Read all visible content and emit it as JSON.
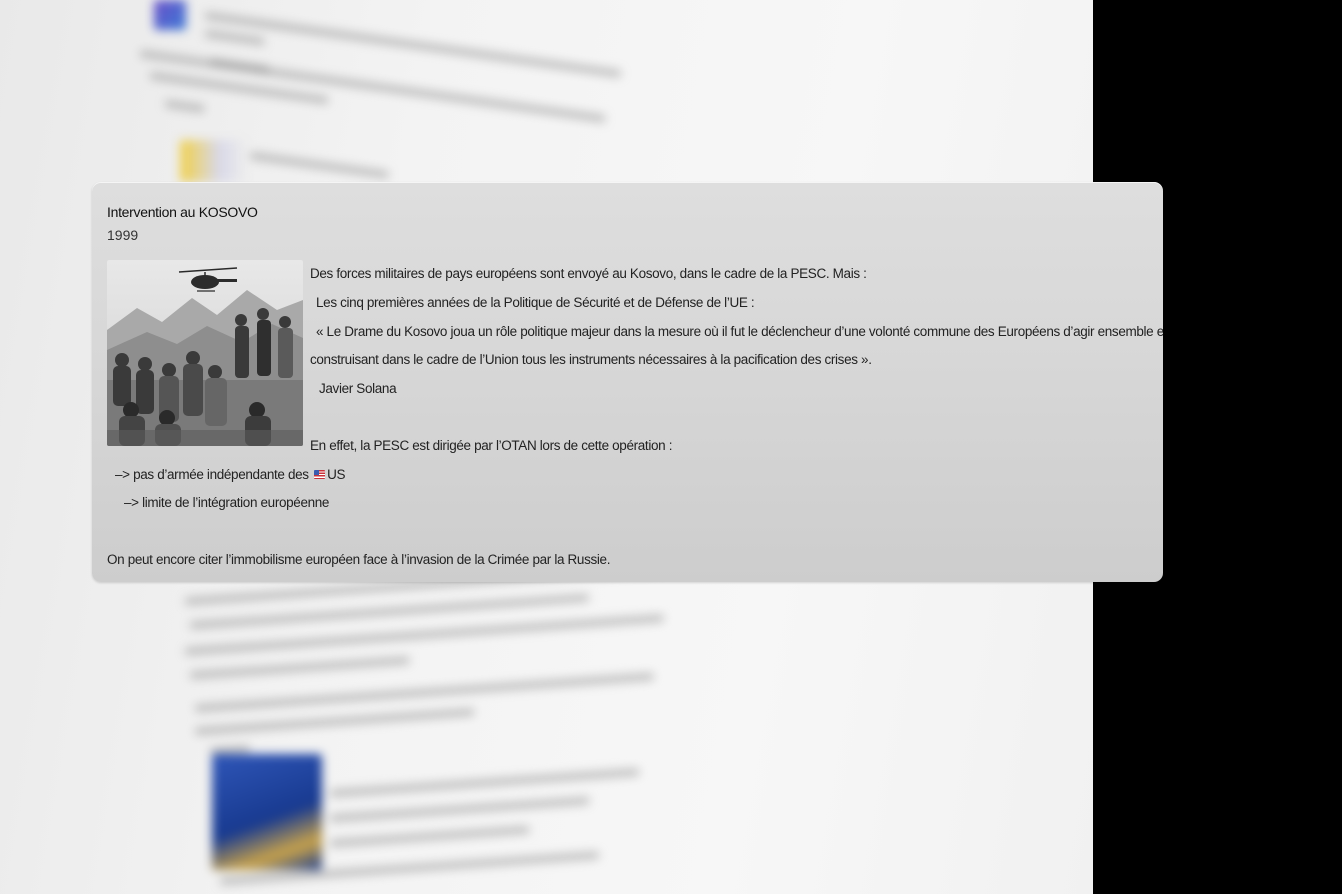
{
  "card": {
    "title": "Intervention au KOSOVO",
    "year": "1999",
    "lines": [
      "Des forces militaires de pays européens sont envoyé au Kosovo, dans le cadre de la PESC. Mais :",
      "Les cinq premières années  de la Politique de Sécurité et de Défense  de l’UE :",
      "« Le Drame du Kosovo joua un rôle politique majeur dans la   mesure où il fut le déclencheur d’une volonté commune des   Européens d’agir ensemble en",
      "construisant dans le cadre de l’Union   tous les  instruments nécessaires à la pacification des crises ».",
      "Javier Solana",
      "En effet, la PESC est dirigée par l’OTAN lors de cette opération :",
      "–> pas d’armée indépendante des ",
      "US",
      "–> limite de l’intégration européenne",
      "On peut encore citer l’immobilisme européen face à l’invasion de la Crimée par la Russie."
    ]
  },
  "icons": {
    "flag": "us-flag-icon",
    "photo": "helicopter-photo"
  },
  "colors": {
    "card_background": "#d8d8d8",
    "backdrop": "#f3f3f3",
    "edge": "#000000"
  }
}
